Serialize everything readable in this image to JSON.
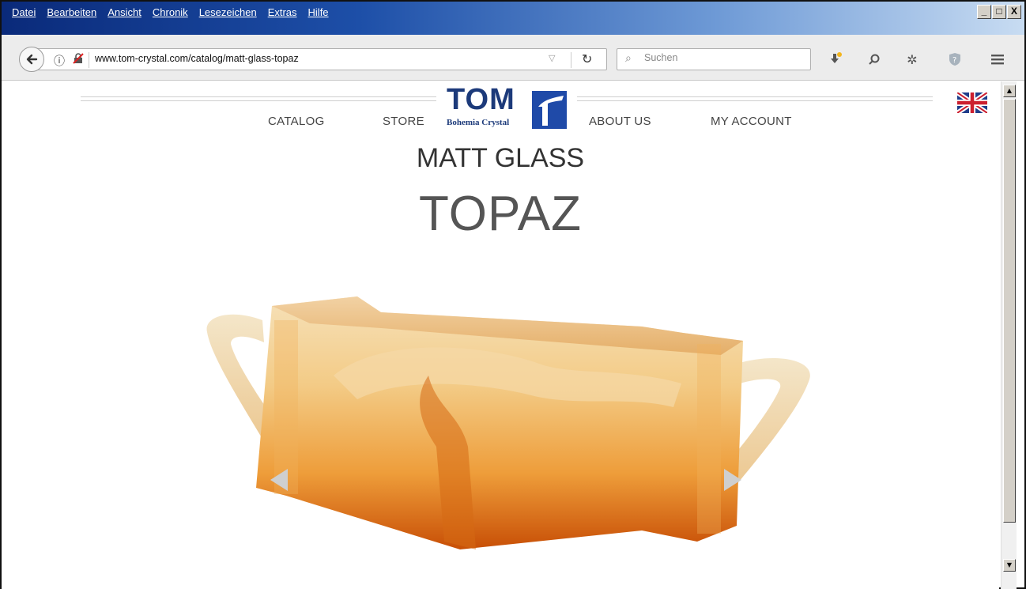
{
  "menubar": {
    "items": [
      "Datei",
      "Bearbeiten",
      "Ansicht",
      "Chronik",
      "Lesezeichen",
      "Extras",
      "Hilfe"
    ],
    "window_controls": {
      "minimize": "_",
      "maximize": "□",
      "close": "X"
    }
  },
  "toolbar": {
    "url": "www.tom-crystal.com/catalog/matt-glass-topaz",
    "search_placeholder": "Suchen"
  },
  "site": {
    "nav": {
      "catalog": "CATALOG",
      "store": "STORE",
      "about": "ABOUT US",
      "account": "MY ACCOUNT"
    },
    "logo": {
      "title": "TOM",
      "subtitle": "Bohemia Crystal"
    },
    "language_flag": "uk-flag-icon"
  },
  "product": {
    "category": "MATT GLASS",
    "name": "TOPAZ"
  },
  "colors": {
    "titlebar_dark": "#0a2a7a",
    "logo_blue": "#1f4aa8",
    "glass_amber": "#e8952a"
  }
}
